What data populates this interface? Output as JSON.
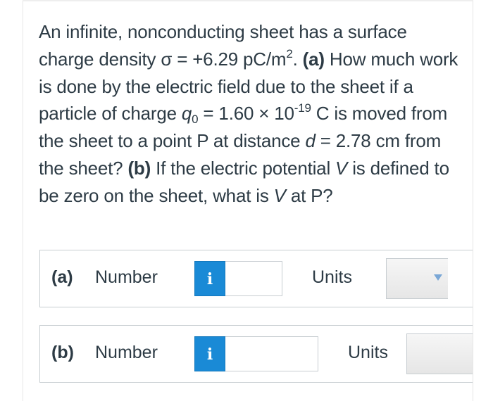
{
  "question": {
    "p1": "An infinite, nonconducting sheet has a surface charge density σ = +6.29 pC/m",
    "p1_sup": "2",
    "p1_end": ". ",
    "part_a_tag": "(a)",
    "p2": " How much work is done by the electric field due to the sheet if a particle of charge ",
    "q_sym": "q",
    "q_sub": "0",
    "p3": " = 1.60 × 10",
    "exp": "-19",
    "p4": " C is moved from the sheet to a point P at distance ",
    "d_sym": "d",
    "p5": " = 2.78 cm from the sheet? ",
    "part_b_tag": "(b)",
    "p6": " If the electric potential ",
    "v_sym": "V",
    "p7": " is defined to be zero on the sheet, what is ",
    "v_sym2": "V",
    "p8": " at P?"
  },
  "answers": {
    "a": {
      "part_label": "(a)",
      "number_label": "Number",
      "info_icon": "i",
      "number_value": "",
      "units_label": "Units",
      "units_value": ""
    },
    "b": {
      "part_label": "(b)",
      "number_label": "Number",
      "info_icon": "i",
      "number_value": "",
      "units_label": "Units",
      "units_value": ""
    }
  },
  "colors": {
    "text": "#2d3b45",
    "info_button": "#1a8ad6",
    "border": "#c7cdd1",
    "dropdown_arrow": "#7aa7d6"
  },
  "icons": {
    "info": "info-icon",
    "dropdown": "chevron-down-icon"
  }
}
